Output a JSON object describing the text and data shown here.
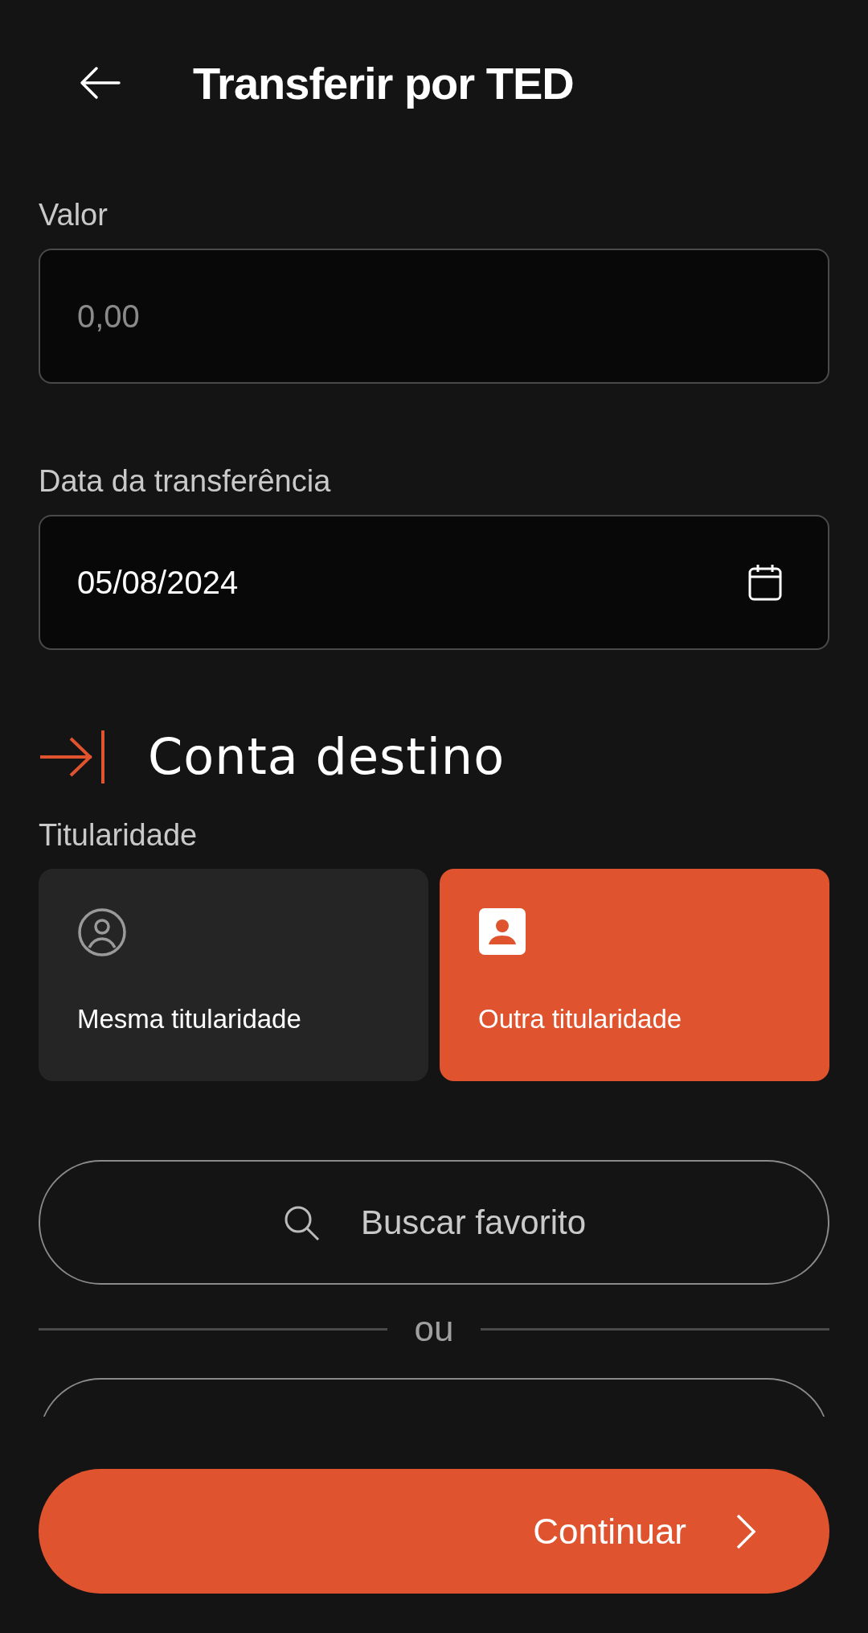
{
  "header": {
    "title": "Transferir por TED"
  },
  "amount": {
    "label": "Valor",
    "placeholder": "0,00"
  },
  "date": {
    "label": "Data da transferência",
    "value": "05/08/2024"
  },
  "section": {
    "title": "Conta destino"
  },
  "ownership": {
    "label": "Titularidade",
    "options": [
      {
        "kind": "same",
        "label": "Mesma titularidade",
        "selected": false
      },
      {
        "kind": "other",
        "label": "Outra titularidade",
        "selected": true
      }
    ]
  },
  "search": {
    "label": "Buscar favorito"
  },
  "divider": {
    "label": "ou"
  },
  "continue_button": {
    "label": "Continuar"
  }
}
